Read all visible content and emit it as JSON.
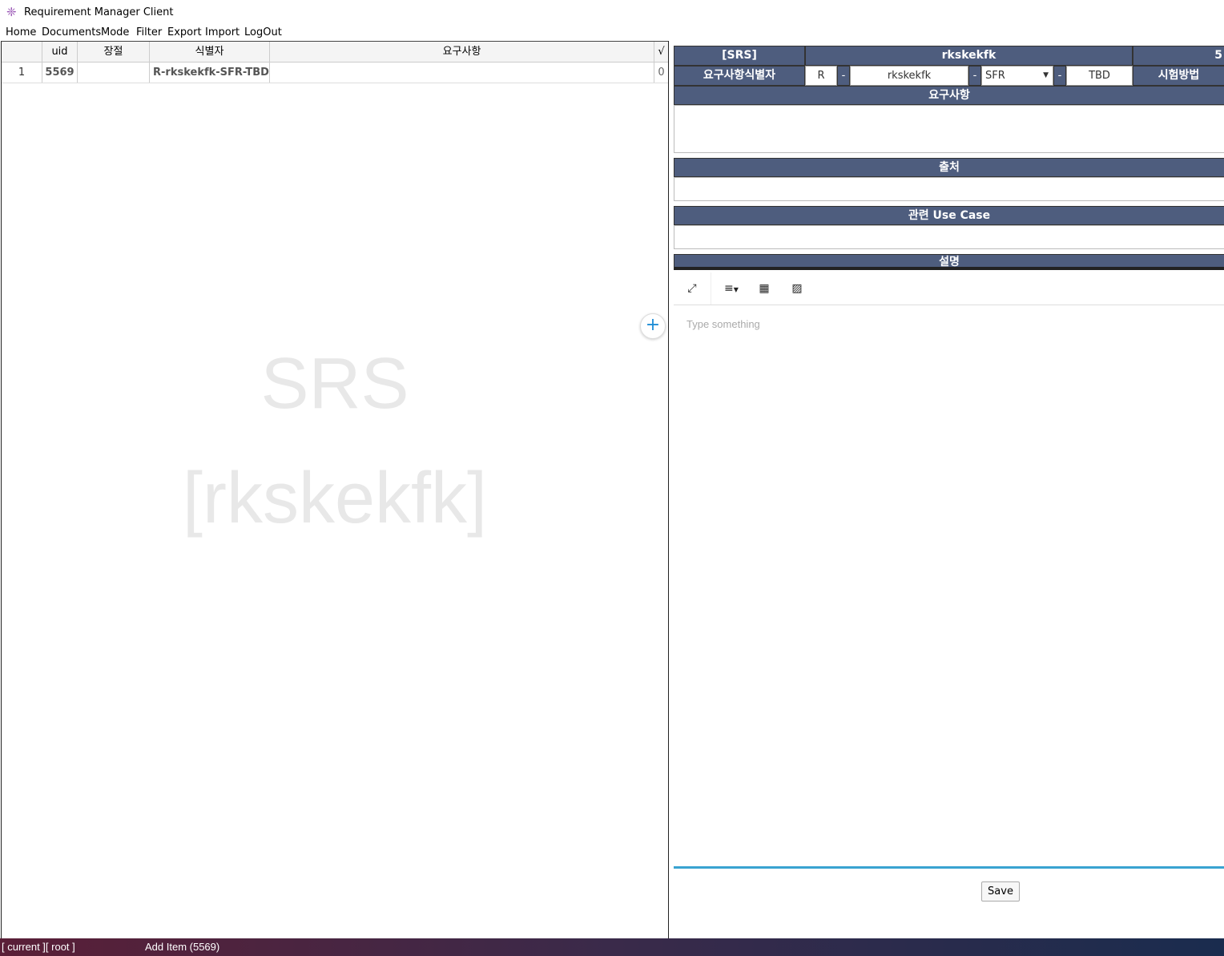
{
  "window": {
    "title": "Requirement Manager Client"
  },
  "menu": [
    "Home",
    "Documents",
    "Mode",
    "Filter",
    "Export",
    "Import",
    "LogOut"
  ],
  "grid": {
    "headers": {
      "row": "",
      "uid": "uid",
      "section": "장절",
      "identifier": "식별자",
      "requirement": "요구사항",
      "check": "√"
    },
    "rows": [
      {
        "num": "1",
        "uid": "5569",
        "section": "",
        "identifier": "R-rkskekfk-SFR-TBD",
        "requirement": "",
        "check": "0"
      }
    ]
  },
  "watermark": {
    "line1": "SRS",
    "line2": "[rkskekfk]"
  },
  "detail": {
    "doc_type": "[SRS]",
    "doc_name": "rkskekfk",
    "doc_num": "5",
    "id_label": "요구사항식별자",
    "id_prefix": "R",
    "id_sep": "-",
    "id_project": "rkskekfk",
    "id_type": "SFR",
    "id_suffix": "TBD",
    "test_method_label": "시험방법",
    "requirement_label": "요구사항",
    "source_label": "출처",
    "usecase_label": "관련 Use Case",
    "description_label": "설명",
    "editor_placeholder": "Type something",
    "save_label": "Save"
  },
  "status": {
    "context": "[ current ][ root ]",
    "message": "Add Item (5569)"
  },
  "colors": {
    "header_bg": "#4e5d7e",
    "accent": "#39a3d1",
    "add_button": "#1f8dd6"
  }
}
